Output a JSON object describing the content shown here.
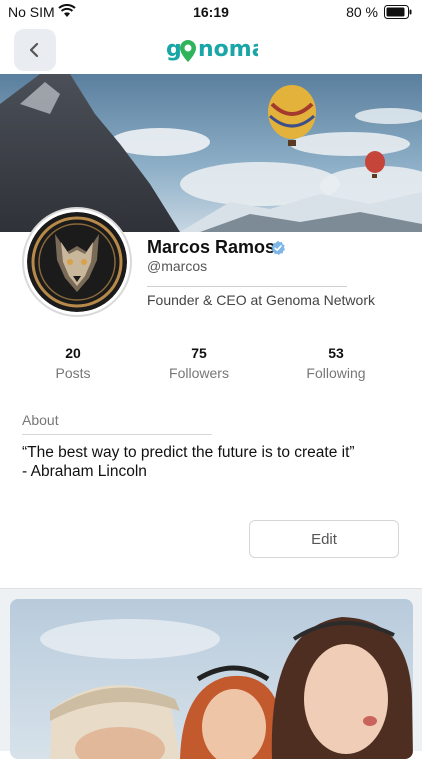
{
  "status_bar": {
    "carrier": "No SIM",
    "time": "16:19",
    "battery": "80 %"
  },
  "nav": {
    "logo": "genoma",
    "back_icon": "chevron-left-icon"
  },
  "profile": {
    "name": "Marcos Ramos",
    "handle": "@marcos",
    "headline": "Founder & CEO at Genoma Network",
    "verified": true
  },
  "stats": [
    {
      "value": "20",
      "label": "Posts"
    },
    {
      "value": "75",
      "label": "Followers"
    },
    {
      "value": "53",
      "label": "Following"
    }
  ],
  "about": {
    "label": "About",
    "text": "“The best way to predict the future is to create it”\n-  Abraham Lincoln"
  },
  "actions": {
    "edit_label": "Edit"
  },
  "colors": {
    "brand": "#1aa6a6",
    "verified": "#4a9be0",
    "feed_bg": "#eef1f4"
  }
}
